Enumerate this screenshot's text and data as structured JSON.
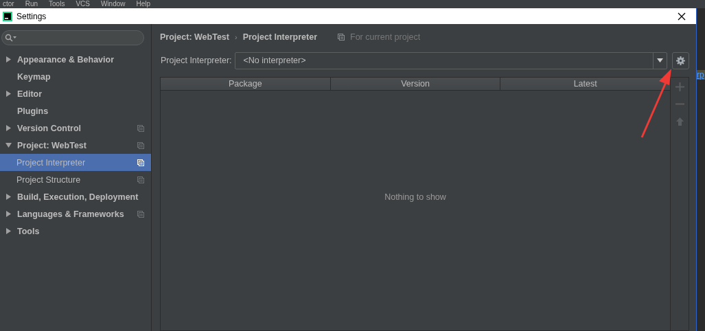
{
  "background_menu": [
    "ctor",
    "Run",
    "Tools",
    "VCS",
    "Window",
    "Help"
  ],
  "background_fragment": "rp",
  "window": {
    "title": "Settings"
  },
  "sidebar": {
    "items": [
      {
        "label": "Appearance & Behavior",
        "expanded": false,
        "scoped": false,
        "selected": false
      },
      {
        "label": "Keymap",
        "scoped": false,
        "selected": false
      },
      {
        "label": "Editor",
        "expanded": false,
        "scoped": false,
        "selected": false
      },
      {
        "label": "Plugins",
        "scoped": false,
        "selected": false
      },
      {
        "label": "Version Control",
        "expanded": false,
        "scoped": true,
        "selected": false
      },
      {
        "label": "Project: WebTest",
        "expanded": true,
        "scoped": true,
        "selected": false,
        "children": [
          {
            "label": "Project Interpreter",
            "scoped": true,
            "selected": true
          },
          {
            "label": "Project Structure",
            "scoped": true,
            "selected": false
          }
        ]
      },
      {
        "label": "Build, Execution, Deployment",
        "expanded": false,
        "scoped": false,
        "selected": false
      },
      {
        "label": "Languages & Frameworks",
        "expanded": false,
        "scoped": true,
        "selected": false
      },
      {
        "label": "Tools",
        "expanded": false,
        "scoped": false,
        "selected": false
      }
    ]
  },
  "breadcrumb": [
    "Project: WebTest",
    "Project Interpreter"
  ],
  "breadcrumb_separator": "›",
  "scope_note": "For current project",
  "interpreter": {
    "label": "Project Interpreter:",
    "value": "<No interpreter>"
  },
  "table": {
    "columns": [
      "Package",
      "Version",
      "Latest"
    ],
    "empty_text": "Nothing to show"
  },
  "table_tools": [
    {
      "kind": "add",
      "disabled": true
    },
    {
      "kind": "remove",
      "disabled": true
    },
    {
      "kind": "upgrade",
      "disabled": true
    }
  ]
}
